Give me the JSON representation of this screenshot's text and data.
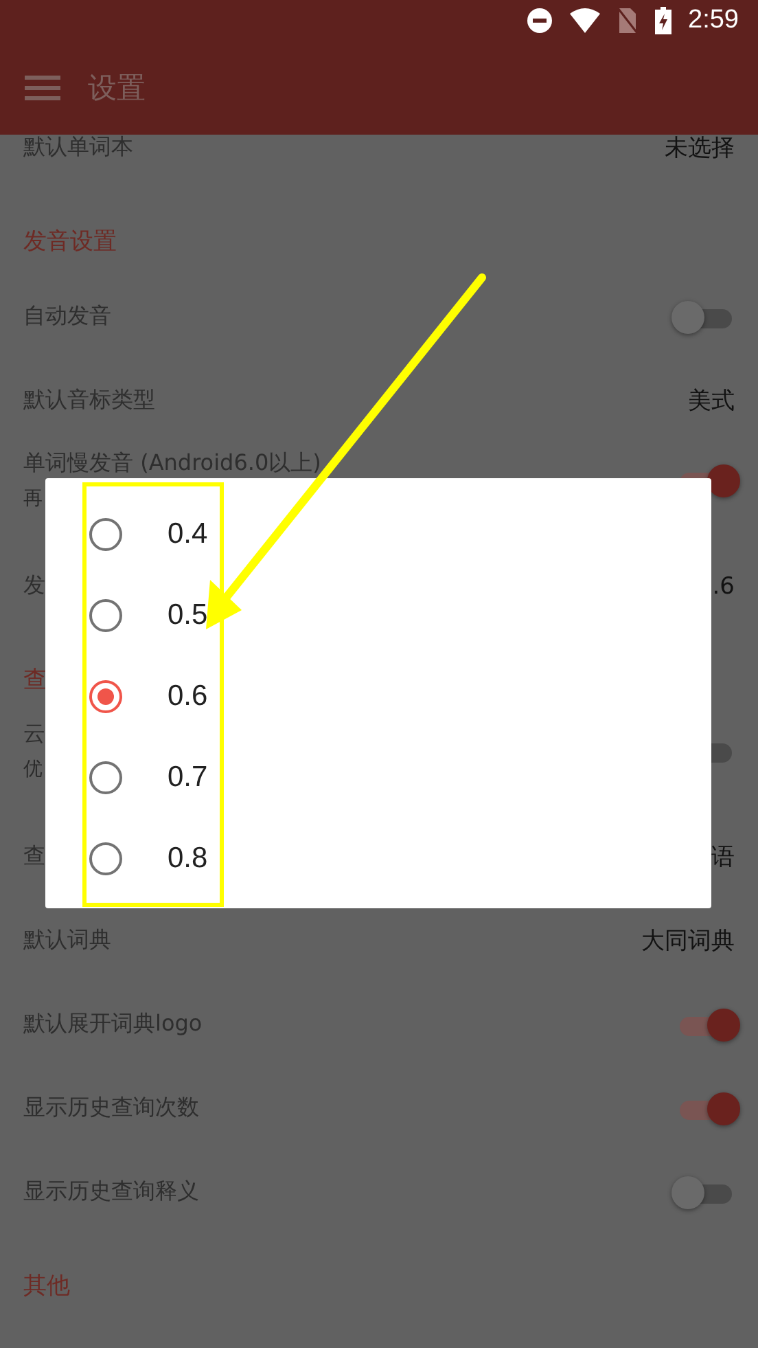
{
  "status_bar": {
    "time": "2:59"
  },
  "app_bar": {
    "title": "设置"
  },
  "settings": [
    {
      "kind": "row",
      "label": "默认单词本",
      "value": "未选择"
    },
    {
      "kind": "header",
      "label": "发音设置"
    },
    {
      "kind": "toggle",
      "label": "自动发音",
      "on": false
    },
    {
      "kind": "row",
      "label": "默认音标类型",
      "value": "美式"
    },
    {
      "kind": "toggle",
      "label": "单词慢发音 (Android6.0以上)",
      "subtitle": "再",
      "on": true
    },
    {
      "kind": "row",
      "label": "发",
      "value": ".6"
    },
    {
      "kind": "header",
      "label": "查"
    },
    {
      "kind": "toggle",
      "label": "云",
      "subtitle": "优",
      "on": false
    },
    {
      "kind": "row",
      "label": "查",
      "value": "语"
    },
    {
      "kind": "row",
      "label": "默认词典",
      "value": "大同词典"
    },
    {
      "kind": "toggle",
      "label": "默认展开词典logo",
      "on": true
    },
    {
      "kind": "toggle",
      "label": "显示历史查询次数",
      "on": true
    },
    {
      "kind": "toggle",
      "label": "显示历史查询释义",
      "on": false
    },
    {
      "kind": "header",
      "label": "其他"
    }
  ],
  "dialog": {
    "options": [
      {
        "label": "0.4",
        "selected": false
      },
      {
        "label": "0.5",
        "selected": false
      },
      {
        "label": "0.6",
        "selected": true
      },
      {
        "label": "0.7",
        "selected": false
      },
      {
        "label": "0.8",
        "selected": false
      }
    ]
  }
}
